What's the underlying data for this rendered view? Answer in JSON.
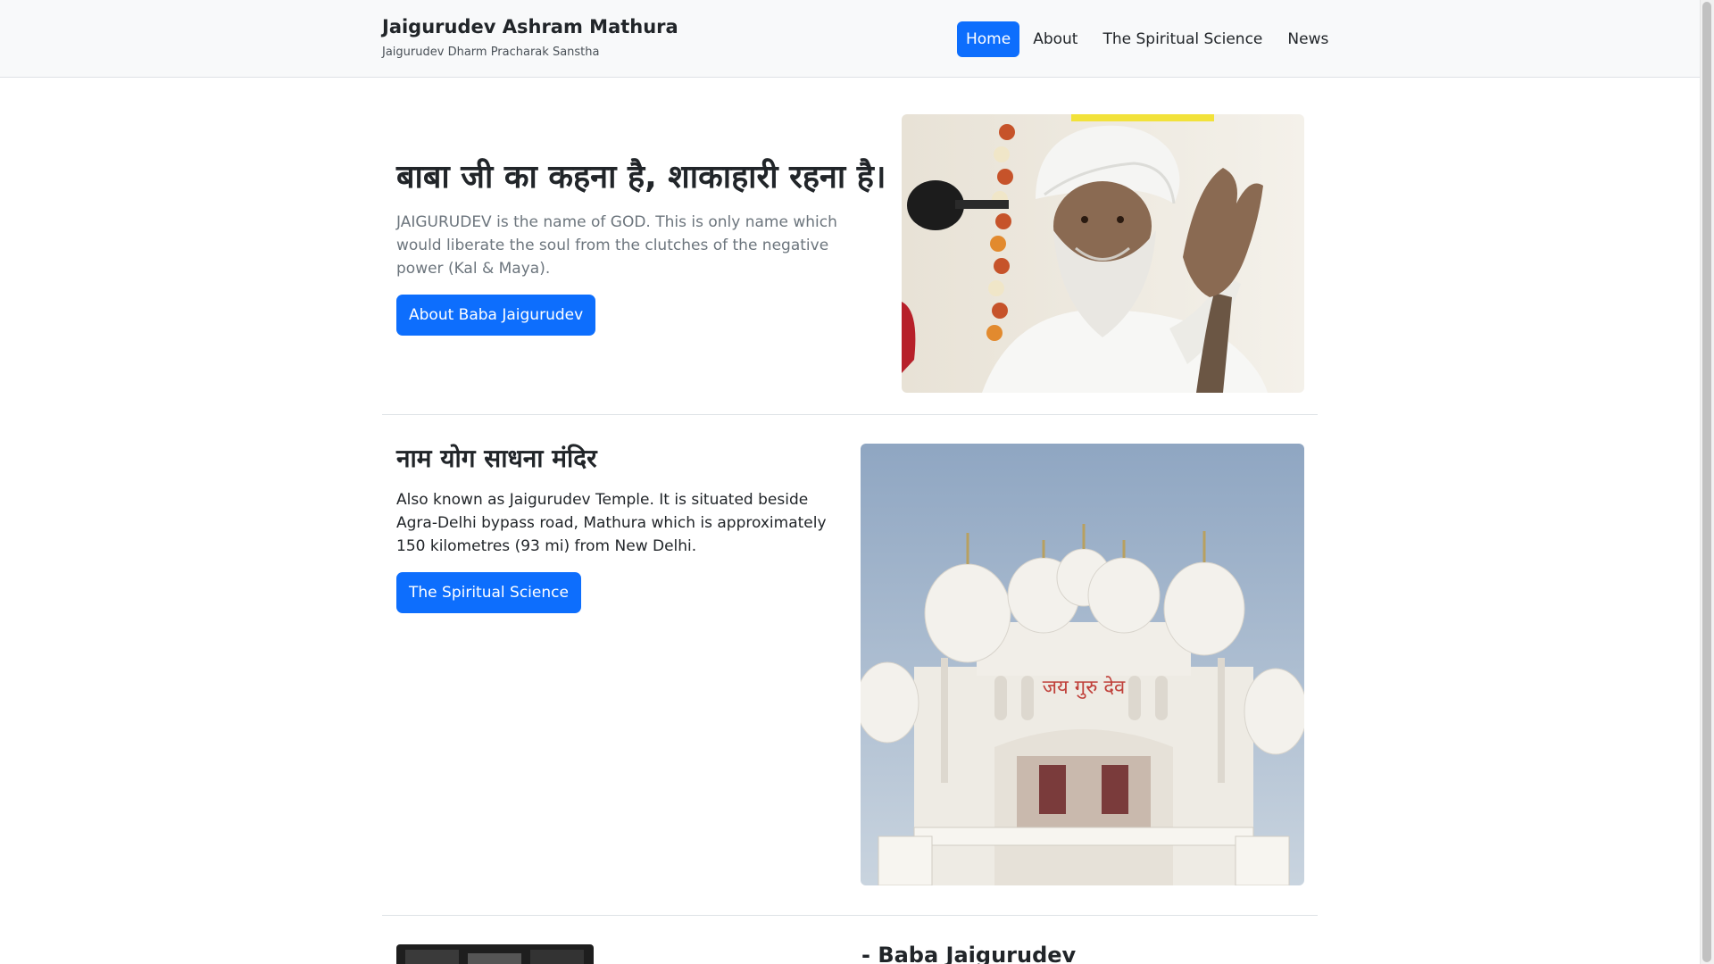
{
  "header": {
    "brand_title": "Jaigurudev Ashram Mathura",
    "brand_subtitle": "Jaigurudev Dharm Pracharak Sanstha",
    "nav": [
      "Home",
      "About",
      "The Spiritual Science",
      "News"
    ],
    "active_nav": "Home"
  },
  "hero": {
    "heading": "बाबा जी का कहना है, शाकाहारी रहना है।",
    "text": "JAIGURUDEV is the name of GOD. This is only name which would liberate the soul from the clutches of the negative power (Kal & Maya).",
    "button_label": "About Baba Jaigurudev",
    "image_icon": "baba-jaigurudev-portrait"
  },
  "temple": {
    "heading": "नाम योग साधना मंदिर",
    "text": "Also known as Jaigurudev Temple. It is situated beside Agra-Delhi bypass road, Mathura which is approximately 150 kilometres (93 mi) from New Delhi.",
    "button_label": "The Spiritual Science",
    "image_icon": "temple-photo",
    "temple_sign": "जय गुरु देव"
  },
  "quote": {
    "heading": "- Baba Jaigurudev",
    "image_icon": "baba-jaigurudev-bw-photo"
  },
  "colors": {
    "primary": "#0d6efd",
    "navbar_bg": "#f8f9fa",
    "muted_text": "#6c757d"
  }
}
